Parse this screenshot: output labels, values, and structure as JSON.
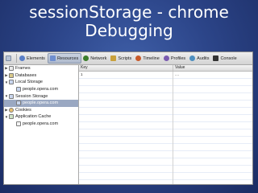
{
  "slide": {
    "title_line1": "sessionStorage  - chrome",
    "title_line2": "Debugging"
  },
  "toolbar": {
    "tabs": [
      {
        "label": "Elements",
        "icon": "elements-icon",
        "color": "#5a7fc7"
      },
      {
        "label": "Resources",
        "icon": "resources-icon",
        "color": "#6f8fcf",
        "active": true
      },
      {
        "label": "Network",
        "icon": "network-icon",
        "color": "#3b7d2b"
      },
      {
        "label": "Scripts",
        "icon": "scripts-icon",
        "color": "#c9a13c"
      },
      {
        "label": "Timeline",
        "icon": "timeline-icon",
        "color": "#c85a2a"
      },
      {
        "label": "Profiles",
        "icon": "profiles-icon",
        "color": "#7a5bb0"
      },
      {
        "label": "Audits",
        "icon": "audits-icon",
        "color": "#4d8fc0"
      },
      {
        "label": "Console",
        "icon": "console-icon",
        "color": "#333333"
      }
    ]
  },
  "sidebar": {
    "frames": "Frames",
    "databases": "Databases",
    "local_storage": "Local Storage",
    "local_storage_item": "people.opera.com",
    "session_storage": "Session Storage",
    "session_storage_item": "people.opera.com",
    "cookies": "Cookies",
    "app_cache": "Application Cache",
    "app_cache_item": "people.opera.com"
  },
  "grid": {
    "col_key": "Key",
    "col_value": "Value",
    "row_key": "1",
    "row_value": "...."
  }
}
